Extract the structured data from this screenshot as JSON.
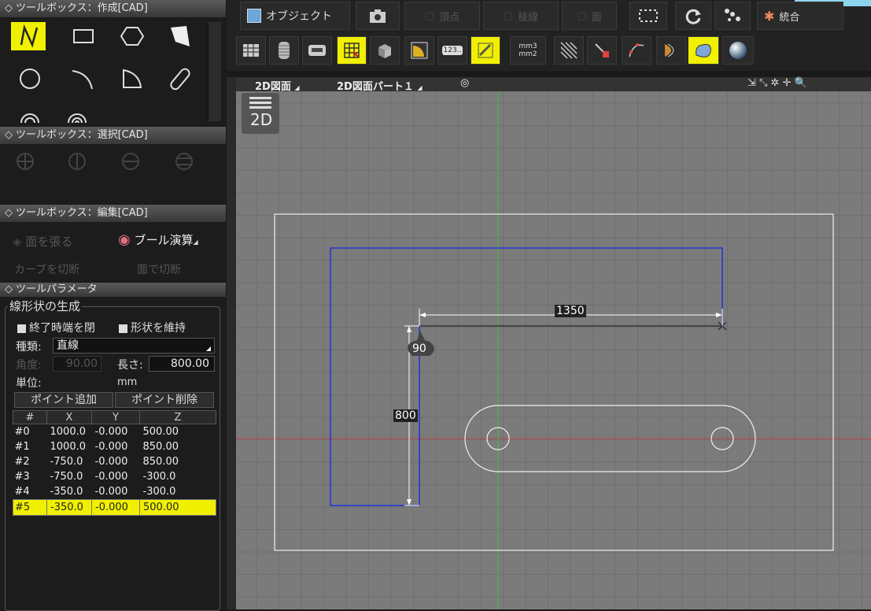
{
  "toolbox_create": {
    "title": "ツールボックス：作成[CAD]"
  },
  "toolbox_select": {
    "title": "ツールボックス：選択[CAD]"
  },
  "toolbox_edit": {
    "title": "ツールボックス：編集[CAD]",
    "face_label": "面を張る",
    "boolean_label": "ブール演算",
    "cut_curve": "カーブを切断",
    "cut_face": "面で切断"
  },
  "params": {
    "title": "ツールパラメータ",
    "group": "線形状の生成",
    "close_at_end": "終了時端を閉",
    "keep_shape": "形状を維持",
    "type_label": "種類:",
    "type_value": "直線",
    "angle_label": "角度:",
    "angle_value": "90.00",
    "length_label": "長さ:",
    "length_value": "800.00",
    "unit_label": "単位:",
    "unit_value": "mm",
    "add_point": "ポイント追加",
    "delete_point": "ポイント削除",
    "columns": [
      "#",
      "X",
      "Y",
      "Z"
    ],
    "rows": [
      [
        "#0",
        "1000.0",
        "-0.000",
        "500.00"
      ],
      [
        "#1",
        "1000.0",
        "-0.000",
        "850.00"
      ],
      [
        "#2",
        "-750.0",
        "-0.000",
        "850.00"
      ],
      [
        "#3",
        "-750.0",
        "-0.000",
        "-300.0"
      ],
      [
        "#4",
        "-350.0",
        "-0.000",
        "-300.0"
      ],
      [
        "#5",
        "-350.0",
        "-0.000",
        "500.00"
      ]
    ],
    "selected_row": 5
  },
  "toolbar": {
    "object_label": "オブジェクト",
    "vertex_label": "頂点",
    "edge_label": "稜線",
    "face_label": "面",
    "merge_label": "統合",
    "num_button": "123..",
    "unit_button_top": "mm3",
    "unit_button_bottom": "mm2"
  },
  "view": {
    "view_menu": "2D図面",
    "part_menu": "2D図面パート１",
    "badge": "2D",
    "dim_horizontal": "1350",
    "dim_vertical": "800",
    "angle_tag": "90"
  },
  "colors": {
    "highlight": "#f0f000",
    "canvas": "#7b7b7b",
    "polyline": "#2233dd",
    "x_axis": "#c04040",
    "y_axis": "#40c040"
  }
}
